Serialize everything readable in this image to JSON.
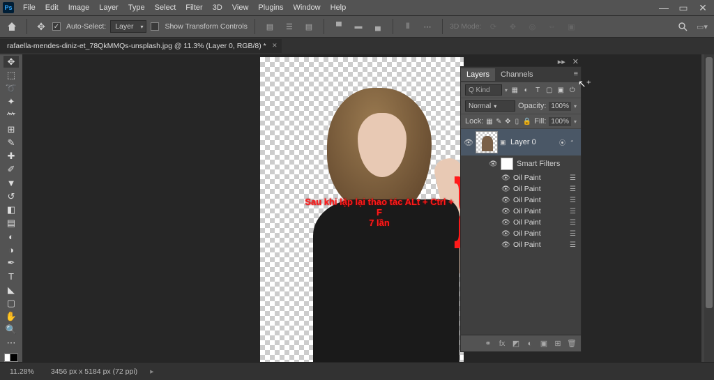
{
  "menu": {
    "items": [
      "File",
      "Edit",
      "Image",
      "Layer",
      "Type",
      "Select",
      "Filter",
      "3D",
      "View",
      "Plugins",
      "Window",
      "Help"
    ]
  },
  "options": {
    "auto_select_label": "Auto-Select:",
    "auto_select_target": "Layer",
    "show_transform_label": "Show Transform Controls",
    "mode3d_label": "3D Mode:"
  },
  "doc": {
    "tab_title": "rafaella-mendes-diniz-et_78QkMMQs-unsplash.jpg @ 11.3% (Layer 0, RGB/8) *"
  },
  "annotation": {
    "line1": "Sau khi lặp lại thao tác ALt + Ctrl + F",
    "line2": "7 lần"
  },
  "layers_panel": {
    "tabs": [
      "Layers",
      "Channels"
    ],
    "filter_label": "Kind",
    "blend_mode": "Normal",
    "opacity_label": "Opacity:",
    "opacity_value": "100%",
    "lock_label": "Lock:",
    "fill_label": "Fill:",
    "fill_value": "100%",
    "layer0": {
      "name": "Layer 0"
    },
    "smart_filters_label": "Smart Filters",
    "filters": [
      "Oil Paint",
      "Oil Paint",
      "Oil Paint",
      "Oil Paint",
      "Oil Paint",
      "Oil Paint",
      "Oil Paint"
    ],
    "search_placeholder": "Q Kind"
  },
  "status": {
    "zoom": "11.28%",
    "doc_info": "3456 px x 5184 px (72 ppi)"
  },
  "tool_icons": [
    "✥",
    "⬚",
    "◯",
    "✦",
    "⺈",
    "⊡",
    "✎",
    "⊕",
    "⚍",
    "↺",
    "✏",
    "⊞",
    "◧",
    "◐",
    "▲",
    "⬯",
    "T",
    "◣",
    "○",
    "✋",
    "🔍",
    "…"
  ]
}
